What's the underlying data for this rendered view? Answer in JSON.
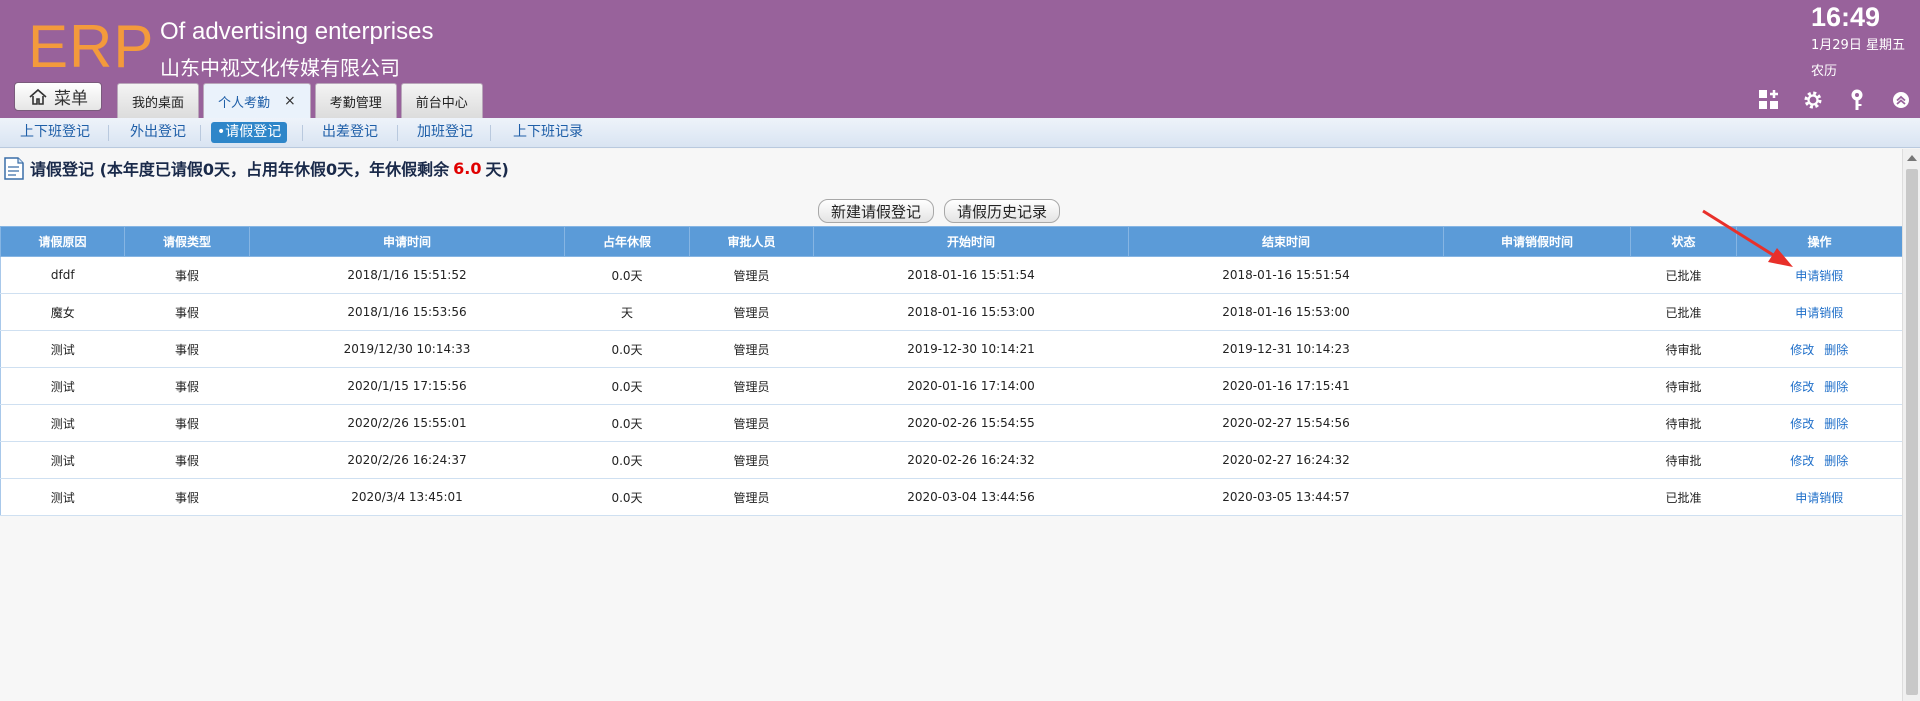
{
  "header": {
    "logo": "ERP",
    "company_en": "Of advertising enterprises",
    "company_cn": "山东中视文化传媒有限公司",
    "time": "16:49",
    "date": "1月29日 星期五",
    "lunar": "农历",
    "menu_label": "菜单",
    "tabs": [
      {
        "label": "我的桌面",
        "active": false
      },
      {
        "label": "个人考勤",
        "active": true,
        "closable": true,
        "close": "×"
      },
      {
        "label": "考勤管理",
        "active": false
      },
      {
        "label": "前台中心",
        "active": false
      }
    ],
    "tool_icons": [
      "grid-plus-icon",
      "gear-icon",
      "key-icon",
      "collapse-up-icon"
    ],
    "colors": {
      "header_bg": "#98629b",
      "logo": "#f39a3c"
    }
  },
  "subnav": {
    "items": [
      {
        "label": "上下班登记",
        "active": false
      },
      {
        "label": "外出登记",
        "active": false
      },
      {
        "label": "•请假登记",
        "active": true
      },
      {
        "label": "出差登记",
        "active": false
      },
      {
        "label": "加班登记",
        "active": false
      },
      {
        "label": "上下班记录",
        "active": false
      }
    ]
  },
  "page": {
    "title_prefix": "请假登记 (本年度已请假0天，占用年休假0天，年休假剩余",
    "remaining": "6.0",
    "title_suffix": "天)",
    "btn_new": "新建请假登记",
    "btn_history": "请假历史记录"
  },
  "table": {
    "columns": [
      "请假原因",
      "请假类型",
      "申请时间",
      "占年休假",
      "审批人员",
      "开始时间",
      "结束时间",
      "申请销假时间",
      "状态",
      "操作"
    ],
    "rows": [
      {
        "reason": "dfdf",
        "type": "事假",
        "apply_time": "2018/1/16 15:51:52",
        "annual": "0.0天",
        "approver": "管理员",
        "start": "2018-01-16 15:51:54",
        "end": "2018-01-16 15:51:54",
        "cancel_time": "",
        "status": "已批准",
        "status_kind": "ok",
        "ops": [
          "申请销假"
        ]
      },
      {
        "reason": "魔女",
        "type": "事假",
        "apply_time": "2018/1/16 15:53:56",
        "annual": "天",
        "approver": "管理员",
        "start": "2018-01-16 15:53:00",
        "end": "2018-01-16 15:53:00",
        "cancel_time": "",
        "status": "已批准",
        "status_kind": "ok",
        "ops": [
          "申请销假"
        ]
      },
      {
        "reason": "测试",
        "type": "事假",
        "apply_time": "2019/12/30 10:14:33",
        "annual": "0.0天",
        "approver": "管理员",
        "start": "2019-12-30 10:14:21",
        "end": "2019-12-31 10:14:23",
        "cancel_time": "",
        "status": "待审批",
        "status_kind": "wait",
        "ops": [
          "修改",
          "删除"
        ]
      },
      {
        "reason": "测试",
        "type": "事假",
        "apply_time": "2020/1/15 17:15:56",
        "annual": "0.0天",
        "approver": "管理员",
        "start": "2020-01-16 17:14:00",
        "end": "2020-01-16 17:15:41",
        "cancel_time": "",
        "status": "待审批",
        "status_kind": "wait",
        "ops": [
          "修改",
          "删除"
        ]
      },
      {
        "reason": "测试",
        "type": "事假",
        "apply_time": "2020/2/26 15:55:01",
        "annual": "0.0天",
        "approver": "管理员",
        "start": "2020-02-26 15:54:55",
        "end": "2020-02-27 15:54:56",
        "cancel_time": "",
        "status": "待审批",
        "status_kind": "wait",
        "ops": [
          "修改",
          "删除"
        ]
      },
      {
        "reason": "测试",
        "type": "事假",
        "apply_time": "2020/2/26 16:24:37",
        "annual": "0.0天",
        "approver": "管理员",
        "start": "2020-02-26 16:24:32",
        "end": "2020-02-27 16:24:32",
        "cancel_time": "",
        "status": "待审批",
        "status_kind": "wait",
        "ops": [
          "修改",
          "删除"
        ]
      },
      {
        "reason": "测试",
        "type": "事假",
        "apply_time": "2020/3/4 13:45:01",
        "annual": "0.0天",
        "approver": "管理员",
        "start": "2020-03-04 13:44:56",
        "end": "2020-03-05 13:44:57",
        "cancel_time": "",
        "status": "已批准",
        "status_kind": "ok",
        "ops": [
          "申请销假"
        ]
      }
    ]
  },
  "annotation": {
    "color": "#e8302a"
  }
}
